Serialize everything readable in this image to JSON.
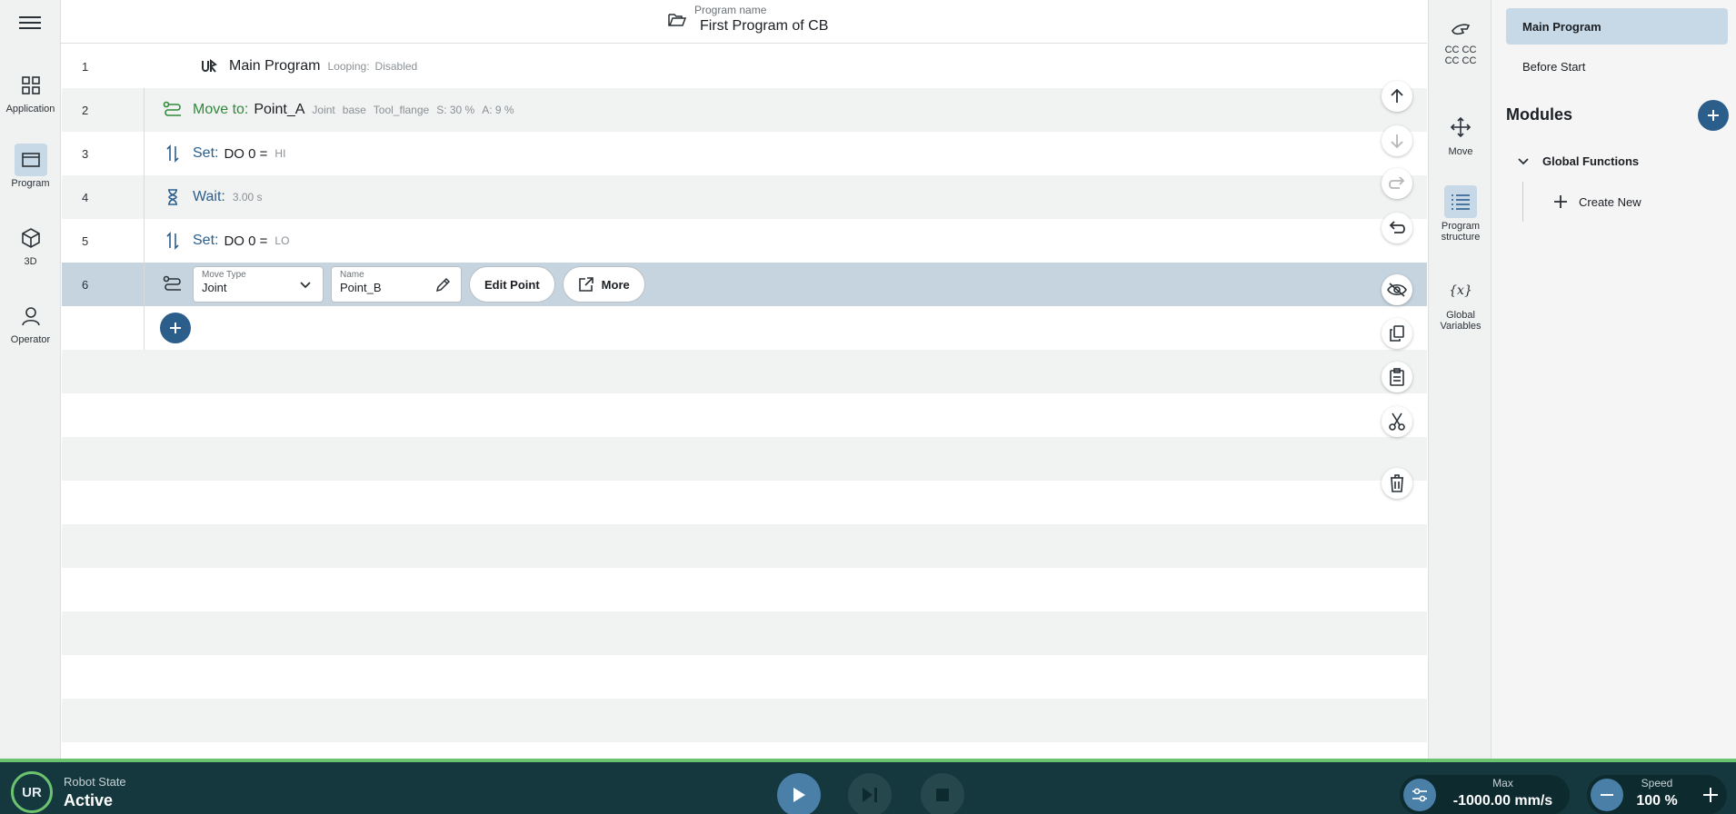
{
  "leftnav": {
    "items": [
      {
        "label": "Application",
        "icon": "grid-icon"
      },
      {
        "label": "Program",
        "icon": "window-icon",
        "active": true
      },
      {
        "label": "3D",
        "icon": "cube-icon"
      },
      {
        "label": "Operator",
        "icon": "person-icon"
      }
    ]
  },
  "header": {
    "program_label": "Program name",
    "program_name": "First Program of CB"
  },
  "program": {
    "rows": [
      {
        "num": "1",
        "title": "Main Program",
        "looping_label": "Looping:",
        "looping_value": "Disabled"
      },
      {
        "num": "2",
        "keyword": "Move to:",
        "target": "Point_A",
        "meta": [
          "Joint",
          "base",
          "Tool_flange",
          "S: 30 %",
          "A: 9 %"
        ]
      },
      {
        "num": "3",
        "keyword": "Set:",
        "target": "DO 0 =",
        "meta": [
          "HI"
        ]
      },
      {
        "num": "4",
        "keyword": "Wait:",
        "meta": [
          "3.00 s"
        ]
      },
      {
        "num": "5",
        "keyword": "Set:",
        "target": "DO 0 =",
        "meta": [
          "LO"
        ]
      },
      {
        "num": "6",
        "move_type_label": "Move Type",
        "move_type_value": "Joint",
        "name_label": "Name",
        "name_value": "Point_B",
        "edit_point_label": "Edit Point",
        "more_label": "More"
      }
    ]
  },
  "righttool": {
    "items": [
      {
        "label": "CC CC\nCC CC",
        "icon": "hand-icon"
      },
      {
        "label": "Move",
        "icon": "move-arrows-icon"
      },
      {
        "label": "Program structure",
        "icon": "list-icon",
        "active": true
      },
      {
        "label": "Global Variables",
        "icon": "variable-icon"
      }
    ]
  },
  "rightpanel": {
    "main_program": "Main Program",
    "before_start": "Before Start",
    "modules_title": "Modules",
    "global_functions": "Global Functions",
    "create_new": "Create New"
  },
  "bottombar": {
    "robot_state_label": "Robot State",
    "robot_state_value": "Active",
    "max_label": "Max",
    "max_value": "-1000.00 mm/s",
    "speed_label": "Speed",
    "speed_value": "100 %"
  },
  "colors": {
    "accent": "#2c5e8c",
    "green": "#2f8a3a",
    "selected_row": "#c5d4de",
    "bottom_bg": "#14383e",
    "status_green": "#6cc36f"
  }
}
